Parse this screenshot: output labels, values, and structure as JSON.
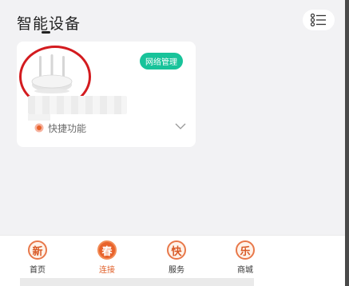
{
  "header": {
    "title": "智能设备",
    "list_view_icon": "list-view-icon"
  },
  "device_card": {
    "image_icon": "router-image",
    "manage_badge": "网络管理",
    "device_name": "",
    "quick_functions_label": "快捷功能",
    "quick_icon": "quick-dot-icon",
    "expand_icon": "chevron-down-icon"
  },
  "bottom_nav": {
    "items": [
      {
        "glyph": "新",
        "label": "首页",
        "active": false
      },
      {
        "glyph": "春",
        "label": "连接",
        "active": true
      },
      {
        "glyph": "快",
        "label": "服务",
        "active": false
      },
      {
        "glyph": "乐",
        "label": "商城",
        "active": false
      }
    ]
  },
  "colors": {
    "accent_orange": "#e8622b",
    "badge_green": "#18c39a",
    "highlight_red": "#d31b1f"
  }
}
